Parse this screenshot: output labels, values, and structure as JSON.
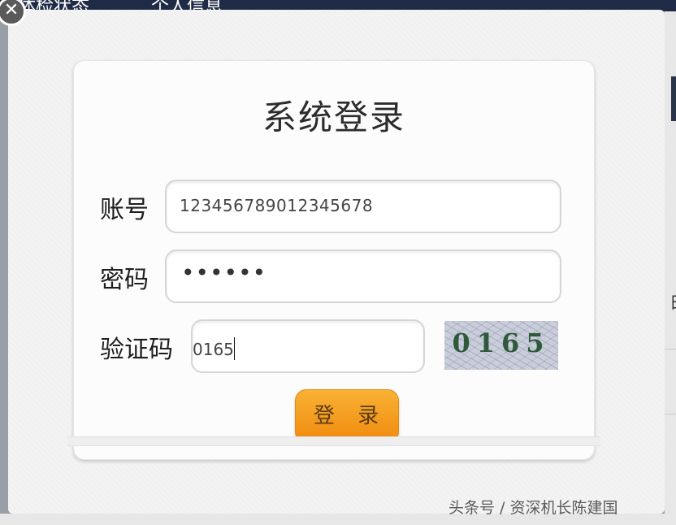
{
  "background_app": {
    "tabs": [
      "体检状态",
      "个人信息"
    ],
    "right_fragment": "日"
  },
  "dialog": {
    "close_glyph": "✕",
    "title": "系统登录",
    "account": {
      "label": "账号",
      "value": "123456789012345678"
    },
    "password": {
      "label": "密码",
      "value": "••••••"
    },
    "captcha": {
      "label": "验证码",
      "value": "0165",
      "image_code": "0165"
    },
    "login_label": "登 录"
  },
  "watermark": "头条号 / 资深机长陈建国",
  "colors": {
    "login_button": "#f5a020",
    "background_bar": "#1f2b46",
    "captcha_text": "#2f5a3a"
  }
}
